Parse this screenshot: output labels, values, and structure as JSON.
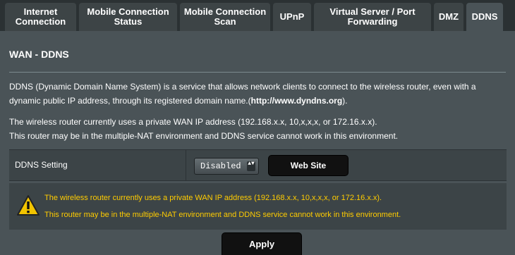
{
  "tabs": [
    {
      "label": "Internet\nConnection",
      "active": false
    },
    {
      "label": "Mobile Connection\nStatus",
      "active": false
    },
    {
      "label": "Mobile Connection\nScan",
      "active": false
    },
    {
      "label": "UPnP",
      "active": false
    },
    {
      "label": "Virtual Server / Port\nForwarding",
      "active": false
    },
    {
      "label": "DMZ",
      "active": false
    },
    {
      "label": "DDNS",
      "active": true
    }
  ],
  "page_title": "WAN - DDNS",
  "description": {
    "line1": "DDNS (Dynamic Domain Name System) is a service that allows network clients to connect to the wireless router, even with a",
    "line2_prefix": "dynamic public IP address, through its registered domain name.(",
    "line2_link": "http://www.dyndns.org",
    "line2_suffix": ")."
  },
  "notice": {
    "line1": "The wireless router currently uses a private WAN IP address (192.168.x.x, 10,x,x,x, or 172.16.x.x).",
    "line2": "This router may be in the multiple-NAT environment and DDNS service cannot work in this environment."
  },
  "ddns_setting": {
    "label": "DDNS Setting",
    "selected": "Disabled",
    "arrows": "▲▼",
    "web_site_button": "Web Site"
  },
  "warning": {
    "icon": "warning-triangle-icon",
    "line1": "The wireless router currently uses a private WAN IP address (192.168.x.x, 10,x,x,x, or 172.16.x.x).",
    "line2": "This router may be in the multiple-NAT environment and DDNS service cannot work in this environment.",
    "color": "#ffcc00"
  },
  "apply_button": "Apply",
  "colors": {
    "background": "#4a5357",
    "tab_bar": "#2b3133",
    "tab": "#3d4446",
    "row": "#3c4447"
  }
}
